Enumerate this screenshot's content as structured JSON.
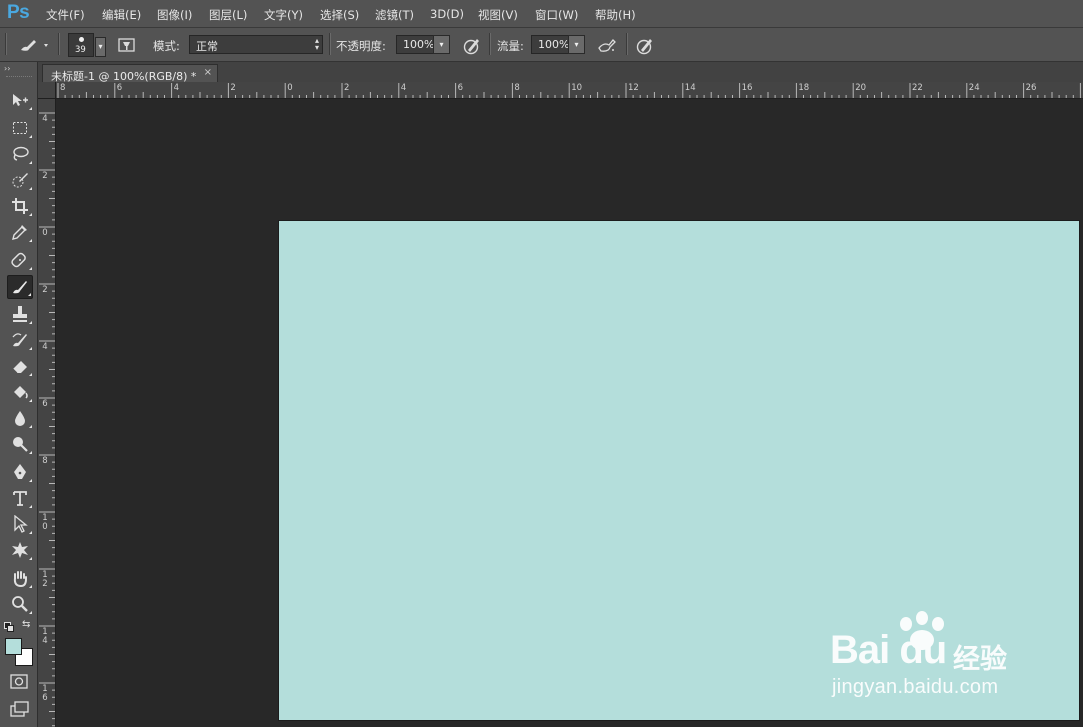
{
  "app": {
    "logo": "Ps"
  },
  "menu": [
    "文件(F)",
    "编辑(E)",
    "图像(I)",
    "图层(L)",
    "文字(Y)",
    "选择(S)",
    "滤镜(T)",
    "3D(D)",
    "视图(V)",
    "窗口(W)",
    "帮助(H)"
  ],
  "options": {
    "brush_size": "39",
    "mode_label": "模式:",
    "mode_value": "正常",
    "opacity_label": "不透明度:",
    "opacity_value": "100%",
    "flow_label": "流量:",
    "flow_value": "100%"
  },
  "document": {
    "tab_title": "未标题-1 @ 100%(RGB/8) *",
    "close": "×",
    "canvas_color": "#b4dedb"
  },
  "rulers": {
    "horizontal": [
      "8",
      "6",
      "4",
      "2",
      "0",
      "2",
      "4",
      "6",
      "8",
      "10",
      "12",
      "14",
      "16",
      "18",
      "20",
      "22",
      "24",
      "26"
    ],
    "vertical": [
      "4",
      "2",
      "0",
      "2",
      "4",
      "6",
      "8",
      "10",
      "12",
      "14",
      "16"
    ]
  },
  "colors": {
    "foreground": "#b4dedb",
    "background": "#ffffff"
  },
  "tools": [
    "move-tool",
    "marquee-tool",
    "lasso-tool",
    "quick-selection-tool",
    "crop-tool",
    "eyedropper-tool",
    "healing-brush-tool",
    "brush-tool",
    "clone-stamp-tool",
    "history-brush-tool",
    "eraser-tool",
    "paint-bucket-tool",
    "blur-tool",
    "dodge-tool",
    "pen-tool",
    "type-tool",
    "path-selection-tool",
    "custom-shape-tool",
    "hand-tool",
    "zoom-tool"
  ],
  "watermark": {
    "brand": "Bai du",
    "brand_cn": "经验",
    "url": "jingyan.baidu.com"
  }
}
